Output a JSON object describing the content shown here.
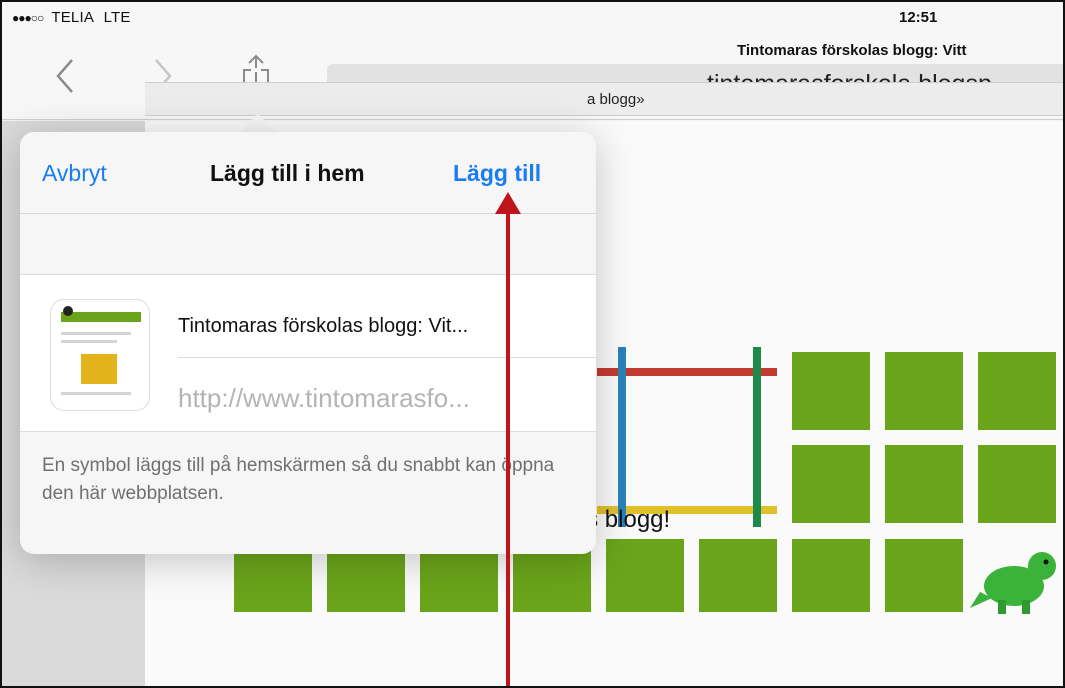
{
  "status": {
    "signal_dots": "●●●○○",
    "carrier": "TELIA",
    "network": "LTE",
    "time": "12:51"
  },
  "toolbar": {
    "back_icon": "chevron-left-icon",
    "forward_icon": "chevron-right-icon",
    "share_icon": "share-icon",
    "url": "tintomarasforskola.blogsp"
  },
  "page": {
    "tab_title": "Tintomaras förskolas blogg: Vitt",
    "breadcrumb": "a blogg»",
    "welcome": "Välkommen till Tintomaras förskolas blogg!",
    "accent": "#6aa41b"
  },
  "popover": {
    "cancel_label": "Avbryt",
    "title": "Lägg till i hem",
    "add_label": "Lägg till",
    "card_title": "Tintomaras förskolas blogg: Vit...",
    "card_url": "http://www.tintomarasfo...",
    "description": "En symbol läggs till på hemskärmen så du snabbt kan öppna den här webbplatsen.",
    "link_color": "#1a7cf0"
  },
  "annotation": {
    "color": "#c0161b"
  }
}
